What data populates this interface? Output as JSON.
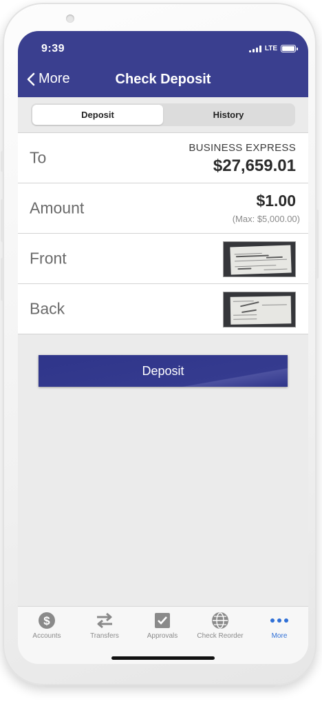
{
  "status_bar": {
    "time": "9:39",
    "network": "LTE"
  },
  "nav": {
    "back_label": "More",
    "title": "Check Deposit"
  },
  "segments": [
    {
      "label": "Deposit",
      "active": true
    },
    {
      "label": "History",
      "active": false
    }
  ],
  "rows": {
    "to": {
      "label": "To",
      "account_name": "BUSINESS EXPRESS",
      "balance": "$27,659.01"
    },
    "amount": {
      "label": "Amount",
      "value": "$1.00",
      "max": "(Max: $5,000.00)"
    },
    "front": {
      "label": "Front",
      "image": "check-front-thumbnail"
    },
    "back": {
      "label": "Back",
      "image": "check-back-thumbnail"
    }
  },
  "deposit_button": "Deposit",
  "tabbar": [
    {
      "label": "Accounts",
      "icon": "dollar-circle-icon",
      "active": false
    },
    {
      "label": "Transfers",
      "icon": "transfer-arrows-icon",
      "active": false
    },
    {
      "label": "Approvals",
      "icon": "checkbox-icon",
      "active": false
    },
    {
      "label": "Check Reorder",
      "icon": "globe-check-icon",
      "active": false
    },
    {
      "label": "More",
      "icon": "more-dots-icon",
      "active": true
    }
  ],
  "colors": {
    "header": "#3a3f8f",
    "button": "#2f358a",
    "active_tab": "#2f6fd6"
  }
}
